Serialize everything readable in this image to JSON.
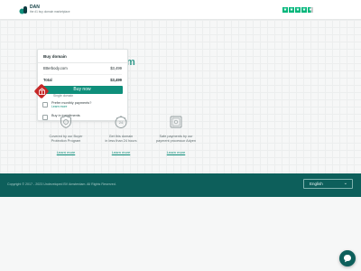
{
  "header": {
    "logo_name": "DAN",
    "logo_tagline": "the #1 buy domain marketplace",
    "trustpilot_stars": 4.5
  },
  "main": {
    "domain_ghost": "m"
  },
  "buy_card": {
    "title": "Buy domain",
    "domain_name": "Btterbody.com",
    "domain_price": "$3,499",
    "total_label": "Total",
    "total_price": "$3,499",
    "buy_button_label": "Buy now",
    "option_under_button": "Single domain",
    "monthly": {
      "label": "Prefer monthly payments?",
      "link": "Learn more"
    },
    "installments": {
      "label": "Buy in installments"
    }
  },
  "features": [
    {
      "text_line1": "Covered by our Buyer",
      "text_line2": "Protection Program",
      "link": "Learn more",
      "icon": "shield-icon"
    },
    {
      "text_line1": "Get this domain",
      "text_line2": "in less than 24 hours",
      "link": "Learn more",
      "icon": "clock-24-icon"
    },
    {
      "text_line1": "Safe payments by our",
      "text_line2": "payment processor Adyen",
      "link": "Learn more",
      "icon": "safe-icon"
    }
  ],
  "footer": {
    "copyright": "Copyright © 2017 - 2023 Undeveloped BV Amsterdam. All Rights Reserved.",
    "language": "English"
  },
  "colors": {
    "accent": "#0f8f7b",
    "footer_bg": "#0d5f5b",
    "trust_green": "#00b67a",
    "badge_red": "#c62828"
  }
}
